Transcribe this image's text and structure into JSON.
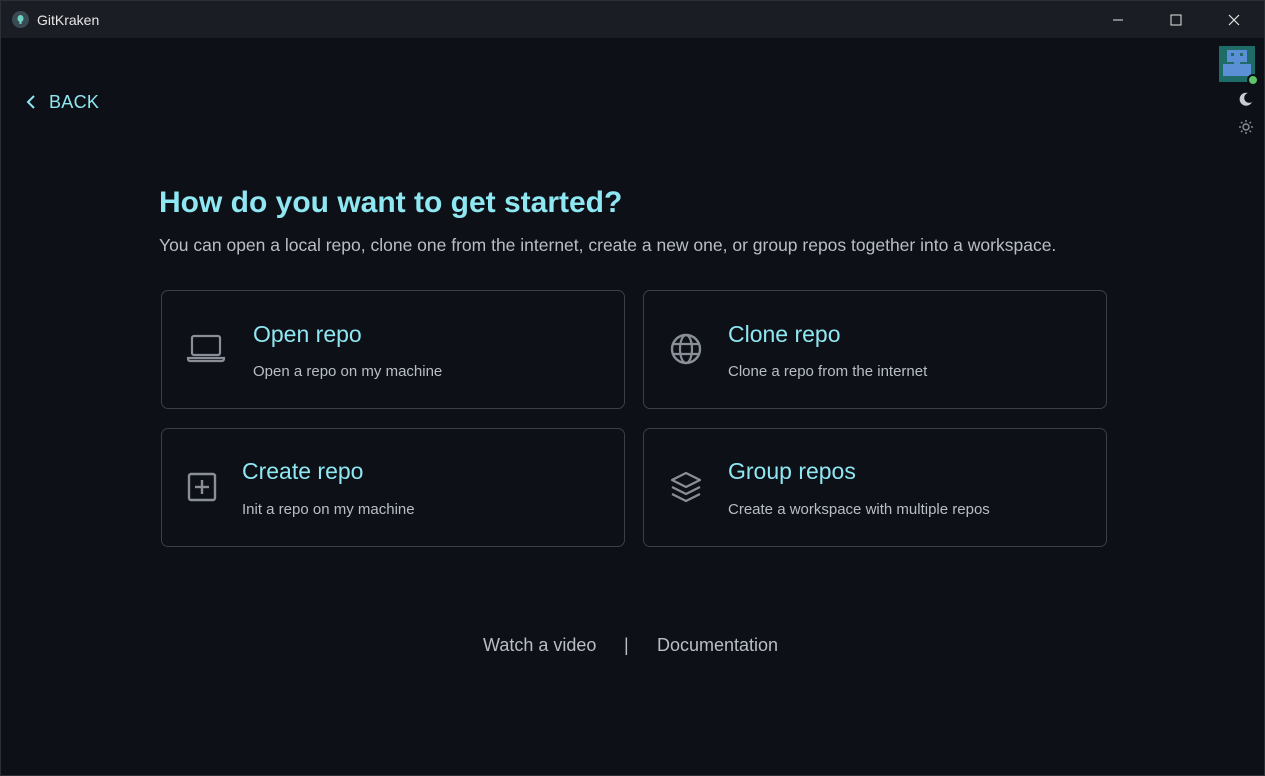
{
  "window": {
    "title": "GitKraken"
  },
  "nav": {
    "back_label": "BACK"
  },
  "page": {
    "heading": "How do you want to get started?",
    "subheading": "You can open a local repo, clone one from the internet, create a new one, or group repos together into a workspace."
  },
  "cards": [
    {
      "title": "Open repo",
      "description": "Open a repo on my machine",
      "icon": "laptop-icon"
    },
    {
      "title": "Clone repo",
      "description": "Clone a repo from the internet",
      "icon": "globe-icon"
    },
    {
      "title": "Create repo",
      "description": "Init a repo on my machine",
      "icon": "plus-square-icon"
    },
    {
      "title": "Group repos",
      "description": "Create a workspace with multiple repos",
      "icon": "layers-icon"
    }
  ],
  "footer": {
    "watch_video": "Watch a video",
    "separator": "|",
    "documentation": "Documentation"
  },
  "colors": {
    "accent": "#8fe7f2",
    "background": "#0d1017",
    "card_border": "#3b3f46",
    "status_online": "#5ec46a"
  }
}
